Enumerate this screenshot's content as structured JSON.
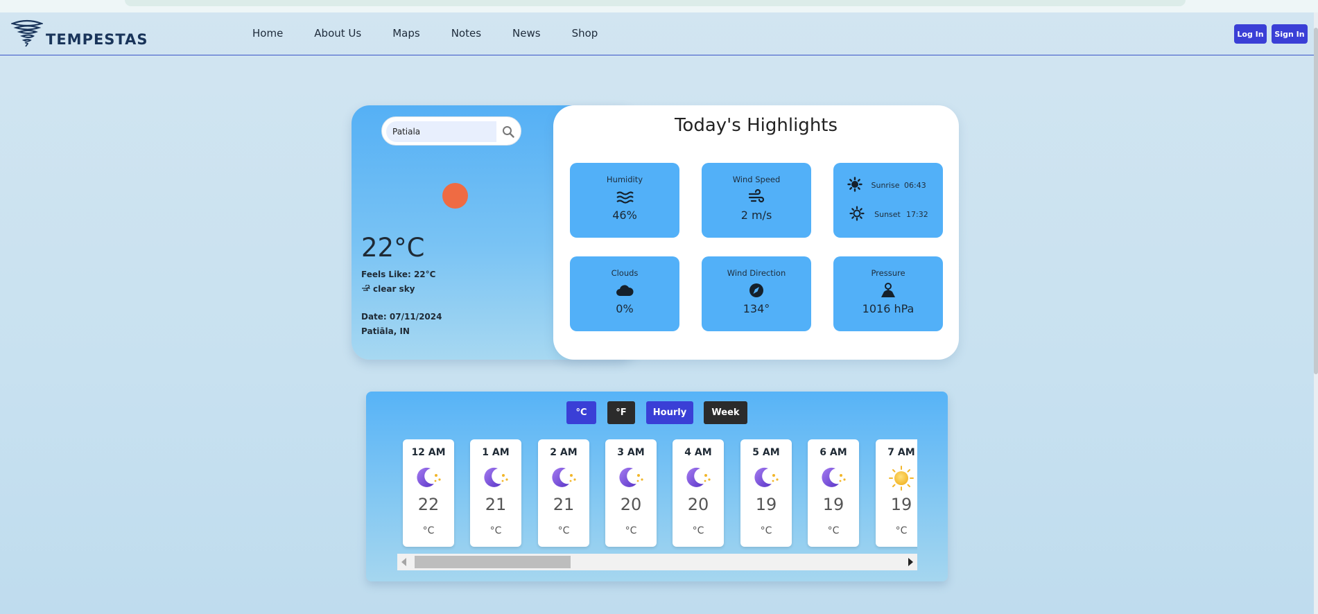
{
  "app": {
    "name": "TEMPESTAS"
  },
  "nav": {
    "links": [
      "Home",
      "About Us",
      "Maps",
      "Notes",
      "News",
      "Shop"
    ],
    "login_label": "Log In",
    "signin_label": "Sign In"
  },
  "search": {
    "value": "Patiala"
  },
  "current": {
    "temp": "22°C",
    "feels_like": "Feels Like: 22°C",
    "description": "clear sky",
    "date": "Date: 07/11/2024",
    "location": "Patiāla, IN"
  },
  "highlights": {
    "title": "Today's Highlights",
    "humidity": {
      "label": "Humidity",
      "value": "46%"
    },
    "wind_speed": {
      "label": "Wind Speed",
      "value": "2 m/s"
    },
    "sunrise": {
      "label": "Sunrise",
      "value": "06:43"
    },
    "sunset": {
      "label": "Sunset",
      "value": "17:32"
    },
    "clouds": {
      "label": "Clouds",
      "value": "0%"
    },
    "wind_direction": {
      "label": "Wind Direction",
      "value": "134°"
    },
    "pressure": {
      "label": "Pressure",
      "value": "1016 hPa"
    }
  },
  "forecast": {
    "toggles": {
      "celsius": "°C",
      "fahrenheit": "°F",
      "hourly": "Hourly",
      "week": "Week"
    },
    "hours": [
      {
        "time": "12 AM",
        "temp": "22",
        "unit": "°C",
        "icon": "moon-stars-icon"
      },
      {
        "time": "1 AM",
        "temp": "21",
        "unit": "°C",
        "icon": "moon-stars-icon"
      },
      {
        "time": "2 AM",
        "temp": "21",
        "unit": "°C",
        "icon": "moon-stars-icon"
      },
      {
        "time": "3 AM",
        "temp": "20",
        "unit": "°C",
        "icon": "moon-stars-icon"
      },
      {
        "time": "4 AM",
        "temp": "20",
        "unit": "°C",
        "icon": "moon-stars-icon"
      },
      {
        "time": "5 AM",
        "temp": "19",
        "unit": "°C",
        "icon": "moon-stars-icon"
      },
      {
        "time": "6 AM",
        "temp": "19",
        "unit": "°C",
        "icon": "moon-stars-icon"
      },
      {
        "time": "7 AM",
        "temp": "19",
        "unit": "°C",
        "icon": "sun-icon"
      }
    ]
  },
  "colors": {
    "accent": "#3a3fd6",
    "dark_button": "#2b2b2b",
    "tile": "#52b0f8",
    "sun_dot": "#ef6b43"
  }
}
